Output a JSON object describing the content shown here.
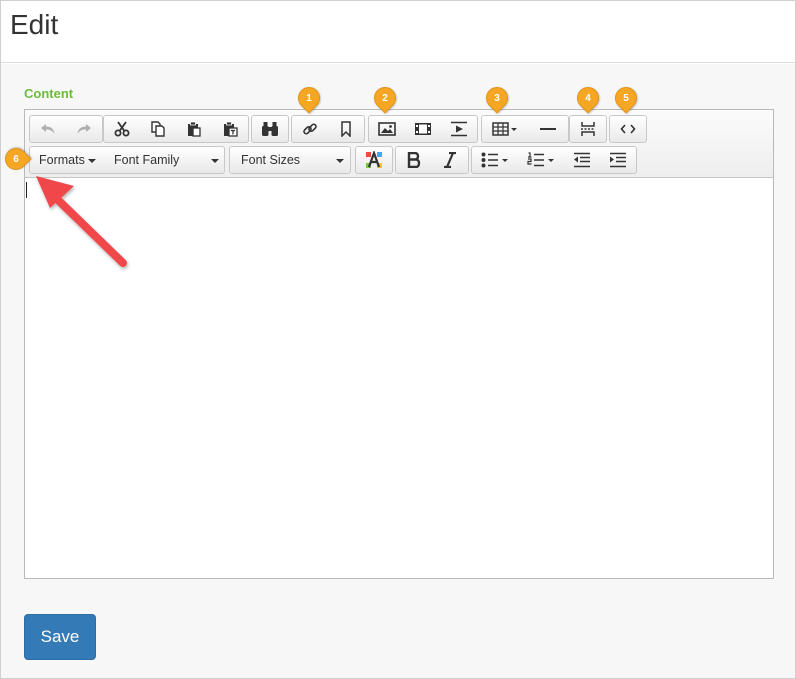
{
  "header": {
    "title": "Edit"
  },
  "content_label": "Content",
  "toolbar": {
    "row1": [
      {
        "name": "undo-button",
        "icon": "undo-icon",
        "disabled": true
      },
      {
        "name": "redo-button",
        "icon": "redo-icon",
        "disabled": true
      },
      {
        "name": "cut-button",
        "icon": "scissors-icon"
      },
      {
        "name": "copy-button",
        "icon": "copy-icon"
      },
      {
        "name": "paste-button",
        "icon": "paste-icon"
      },
      {
        "name": "paste-text-button",
        "icon": "paste-text-icon"
      },
      {
        "name": "find-button",
        "icon": "binoculars-icon"
      },
      {
        "name": "link-button",
        "icon": "link-icon"
      },
      {
        "name": "anchor-button",
        "icon": "bookmark-icon"
      },
      {
        "name": "image-button",
        "icon": "image-icon"
      },
      {
        "name": "media-button",
        "icon": "film-icon"
      },
      {
        "name": "embed-button",
        "icon": "play-icon"
      },
      {
        "name": "table-button",
        "icon": "table-icon"
      },
      {
        "name": "horizontal-rule-button",
        "icon": "horizontal-line-icon"
      },
      {
        "name": "page-break-button",
        "icon": "page-break-icon"
      },
      {
        "name": "source-code-button",
        "icon": "code-icon"
      }
    ],
    "formats_label": "Formats",
    "font_family_label": "Font Family",
    "font_sizes_label": "Font Sizes",
    "row2": [
      {
        "name": "text-color-button",
        "icon": "text-color-icon"
      },
      {
        "name": "bold-button",
        "icon": "bold-icon"
      },
      {
        "name": "italic-button",
        "icon": "italic-icon"
      },
      {
        "name": "bullet-list-button",
        "icon": "bullet-list-icon"
      },
      {
        "name": "numbered-list-button",
        "icon": "numbered-list-icon"
      },
      {
        "name": "outdent-button",
        "icon": "outdent-icon"
      },
      {
        "name": "indent-button",
        "icon": "indent-icon"
      }
    ]
  },
  "markers": [
    "1",
    "2",
    "3",
    "4",
    "5",
    "6"
  ],
  "annotation": {
    "arrow": "red-arrow-icon",
    "marker_color": "#f5a623",
    "arrow_color": "#f0474b"
  },
  "save_button": {
    "label": "Save",
    "color": "#337ab7"
  },
  "colors": {
    "content_label": "#6dbb3a"
  }
}
